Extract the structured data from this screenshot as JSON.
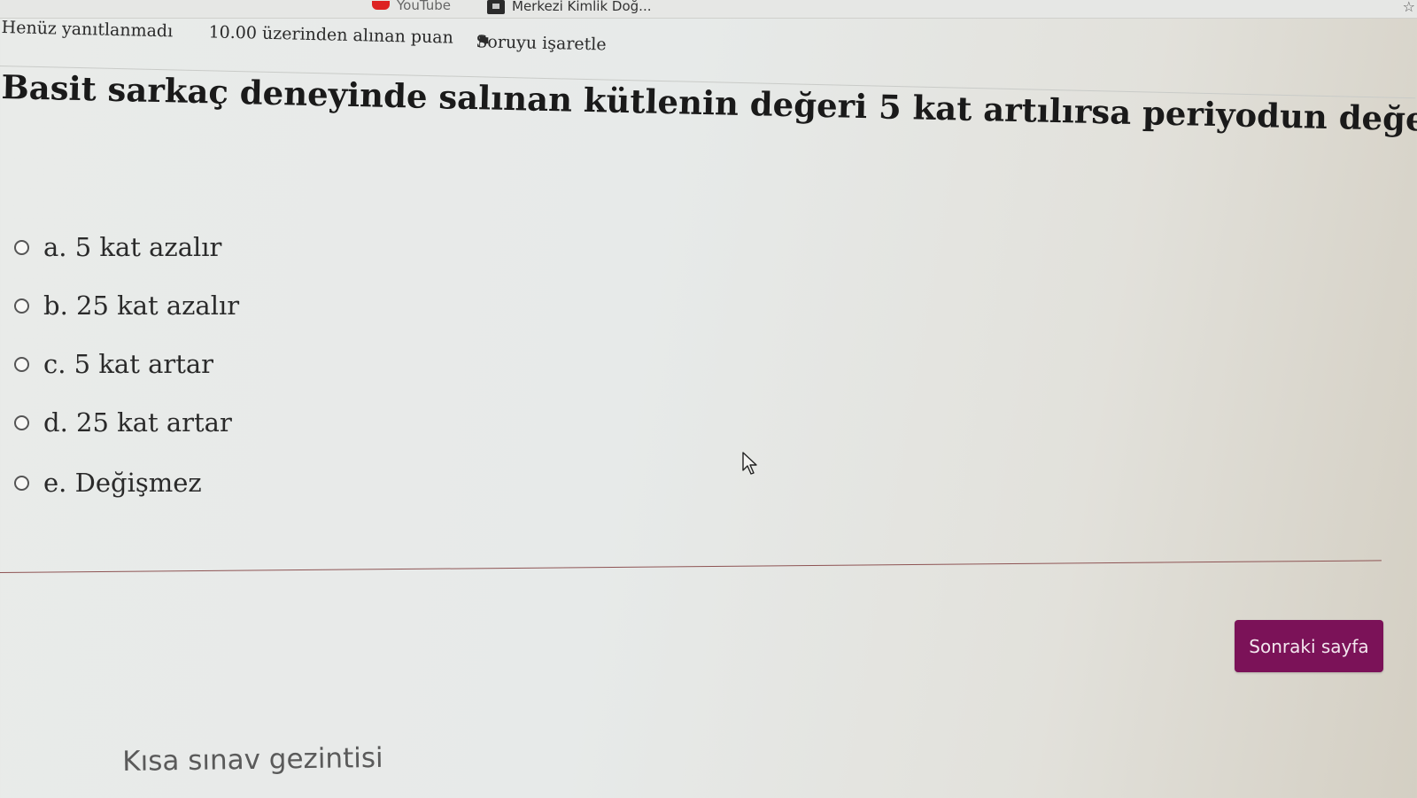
{
  "bookmarks": [
    {
      "label": "YouTube",
      "icon": "youtube-icon"
    },
    {
      "label": "Merkezi Kimlik Doğ...",
      "icon": "site-favicon-icon"
    }
  ],
  "question_info": {
    "state": "Henüz yanıtlanmadı",
    "grade": "10.00 üzerinden alınan puan",
    "flag_label": "Soruyu işaretle",
    "flag_icon": "flag-icon"
  },
  "question": {
    "text": "Basit sarkaç deneyinde salınan kütlenin değeri 5 kat artılırsa periyodun değeri nasıl değişir?",
    "options": [
      {
        "label": "a. 5 kat azalır"
      },
      {
        "label": "b. 25 kat azalır"
      },
      {
        "label": "c. 5 kat artar"
      },
      {
        "label": "d. 25 kat artar"
      },
      {
        "label": "e. Değişmez"
      }
    ]
  },
  "next_button": "Sonraki sayfa",
  "quiz_navigation": "Kısa sınav gezintisi",
  "colors": {
    "primary": "#7b1258",
    "divider": "#8e5454"
  }
}
